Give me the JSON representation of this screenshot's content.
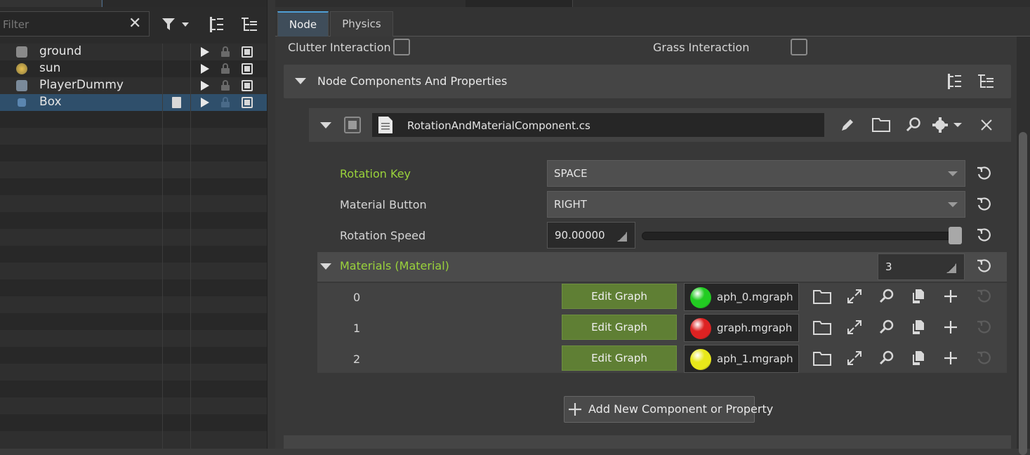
{
  "top_tabs": [
    {
      "label": ""
    },
    {
      "label": ""
    },
    {
      "label": ""
    }
  ],
  "filter": {
    "placeholder": "Filter"
  },
  "tree": {
    "items": [
      {
        "label": "ground",
        "selected": false
      },
      {
        "label": "sun",
        "selected": false
      },
      {
        "label": "PlayerDummy",
        "selected": false
      },
      {
        "label": "Box",
        "selected": true
      }
    ]
  },
  "tabs": [
    {
      "label": "Node",
      "active": true
    },
    {
      "label": "Physics",
      "active": false
    }
  ],
  "interactions": {
    "clutter_label": "Clutter Interaction",
    "grass_label": "Grass Interaction"
  },
  "section": {
    "title": "Node Components And Properties"
  },
  "component": {
    "file": "RotationAndMaterialComponent.cs"
  },
  "properties": {
    "rotation_key": {
      "label": "Rotation Key",
      "value": "SPACE"
    },
    "material_button": {
      "label": "Material Button",
      "value": "RIGHT"
    },
    "rotation_speed": {
      "label": "Rotation Speed",
      "value": "90.00000",
      "slider_fraction": 1.0
    }
  },
  "materials": {
    "label": "Materials (Material)",
    "count": "3",
    "rows": [
      {
        "index": "0",
        "button": "Edit Graph",
        "file": "aph_0.mgraph",
        "color": "#22cc22"
      },
      {
        "index": "1",
        "button": "Edit Graph",
        "file": "graph.mgraph",
        "color": "#dd2222"
      },
      {
        "index": "2",
        "button": "Edit Graph",
        "file": "aph_1.mgraph",
        "color": "#e8e81a"
      }
    ]
  },
  "add_button": {
    "label": "Add New Component or Property"
  },
  "colors": {
    "accent": "#4f9fd6",
    "green_label": "#9ad33b",
    "edit_button": "#5f7f34",
    "selection": "#2f4f6b"
  }
}
